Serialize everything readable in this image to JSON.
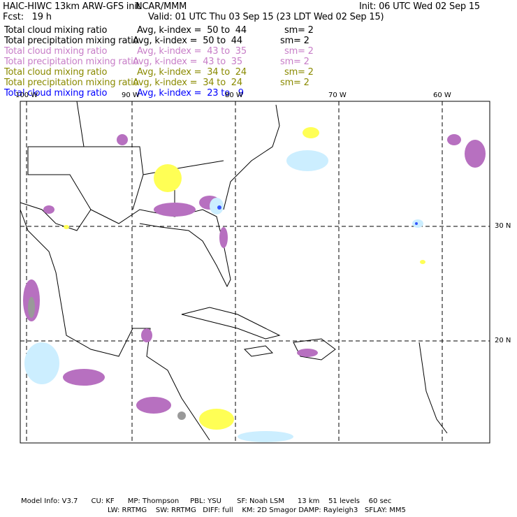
{
  "header": {
    "title": "HAIC-HIWC 13km ARW-GFS init",
    "org": "NCAR/MMM",
    "init": "Init: 06 UTC Wed 02 Sep 15",
    "fcst": "Fcst:   19 h",
    "valid": "Valid: 01 UTC Thu 03 Sep 15 (23 LDT Wed 02 Sep 15)"
  },
  "legend": [
    {
      "field": "Total cloud mixing ratio",
      "range": "Avg, k-index =  50 to  44",
      "sm": "sm= 2",
      "color": "#000000"
    },
    {
      "field": "Total precipitation mixing ratio",
      "range": "Avg, k-index =  50 to  44",
      "sm": "sm= 2",
      "color": "#000000"
    },
    {
      "field": "Total cloud mixing ratio",
      "range": "Avg, k-index =  43 to  35",
      "sm": "sm= 2",
      "color": "#c77dc7"
    },
    {
      "field": "Total precipitation mixing ratio",
      "range": "Avg, k-index =  43 to  35",
      "sm": "sm= 2",
      "color": "#c77dc7"
    },
    {
      "field": "Total cloud mixing ratio",
      "range": "Avg, k-index =  34 to  24",
      "sm": "sm= 2",
      "color": "#8a8a00"
    },
    {
      "field": "Total precipitation mixing ratio",
      "range": "Avg, k-index =  34 to  24",
      "sm": "sm= 2",
      "color": "#8a8a00"
    },
    {
      "field": "Total cloud mixing ratio",
      "range": "Avg, k-index =  23 to   9",
      "sm": "",
      "color": "#0000ff"
    }
  ],
  "map": {
    "lon_labels": [
      "100 W",
      "90 W",
      "80 W",
      "70 W",
      "60 W"
    ],
    "lat_labels": [
      "30 N",
      "20 N"
    ]
  },
  "footer": {
    "line1": "Model Info: V3.7      CU: KF      MP: Thompson     PBL: YSU       SF: Noah LSM      13 km    51 levels    60 sec",
    "line2": "LW: RRTMG    SW: RRTMG   DIFF: full    KM: 2D Smagor DAMP: Rayleigh3   SFLAY: MM5"
  }
}
